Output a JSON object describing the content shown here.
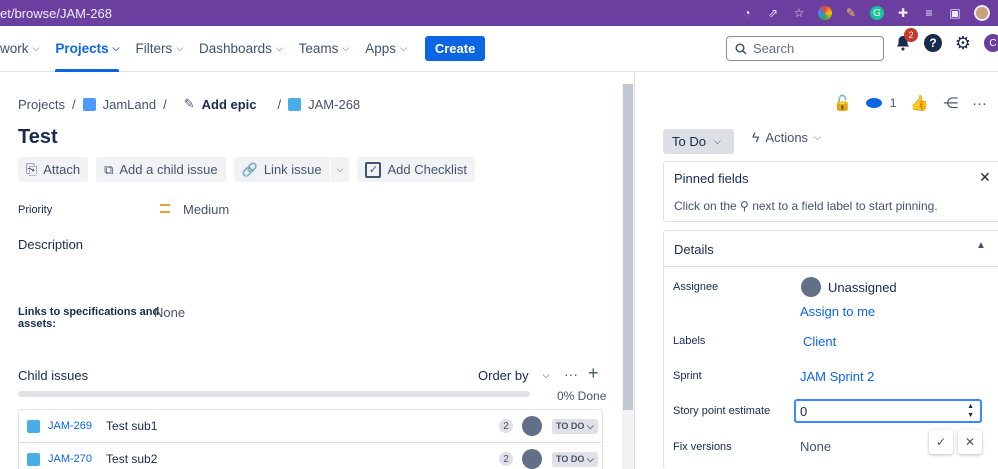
{
  "browser": {
    "url": "et/browse/JAM-268",
    "notification_badge": "2"
  },
  "nav": {
    "items": [
      {
        "label": "work"
      },
      {
        "label": "Projects"
      },
      {
        "label": "Filters"
      },
      {
        "label": "Dashboards"
      },
      {
        "label": "Teams"
      },
      {
        "label": "Apps"
      }
    ],
    "create_label": "Create",
    "search_placeholder": "Search",
    "user_initial": "C"
  },
  "breadcrumb": {
    "projects": "Projects",
    "sep1": "/",
    "project": "JamLand",
    "sep2": "/",
    "add_epic": "Add epic",
    "sep3": "/",
    "issue_key": "JAM-268"
  },
  "issue": {
    "title": "Test",
    "buttons": {
      "attach": "Attach",
      "add_child": "Add a child issue",
      "link": "Link issue",
      "checklist": "Add Checklist"
    },
    "priority_label": "Priority",
    "priority_value": "Medium",
    "description_label": "Description",
    "links_label_1": "Links to specifications and",
    "links_label_2": "assets:",
    "links_value": "None"
  },
  "child_issues": {
    "title": "Child issues",
    "order_by": "Order by",
    "progress_text": "0% Done",
    "progress_percent": 0,
    "rows": [
      {
        "key": "JAM-269",
        "summary": "Test sub1",
        "count": "2",
        "status": "TO DO"
      },
      {
        "key": "JAM-270",
        "summary": "Test sub2",
        "count": "2",
        "status": "TO DO"
      }
    ]
  },
  "right": {
    "watch_count": "1",
    "status": "To Do",
    "actions": "Actions",
    "pinned_title": "Pinned fields",
    "pinned_text_a": "Click on the",
    "pinned_text_b": "next to a field label to start pinning.",
    "details_title": "Details",
    "assignee_label": "Assignee",
    "assignee_value": "Unassigned",
    "assign_me": "Assign to me",
    "labels_label": "Labels",
    "labels_value": "Client",
    "sprint_label": "Sprint",
    "sprint_value": "JAM Sprint 2",
    "sp_label": "Story point estimate",
    "sp_value": "0",
    "fix_label": "Fix versions",
    "fix_value": "None"
  },
  "colors": {
    "accent": "#0c66e4",
    "browser_bar": "#6b3fa0",
    "priority_medium": "#e2a03f"
  }
}
